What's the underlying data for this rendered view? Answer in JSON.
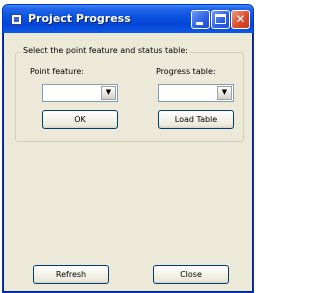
{
  "window": {
    "title": "Project Progress",
    "icons": {
      "app": "app-icon",
      "minimize": "minimize-icon",
      "maximize": "maximize-icon",
      "close": "close-icon"
    },
    "close_glyph": "✕"
  },
  "group": {
    "title": "Select the point feature and status table:",
    "point_feature_label": "Point feature:",
    "progress_table_label": "Progress table:",
    "point_feature_value": "",
    "progress_table_value": "",
    "dropdown_arrow": "▼"
  },
  "buttons": {
    "ok": "OK",
    "load_table": "Load Table",
    "refresh": "Refresh",
    "close": "Close"
  },
  "colors": {
    "titlebar": "#0a53e0",
    "window_face": "#ece9d8",
    "close_button": "#d9482b"
  }
}
